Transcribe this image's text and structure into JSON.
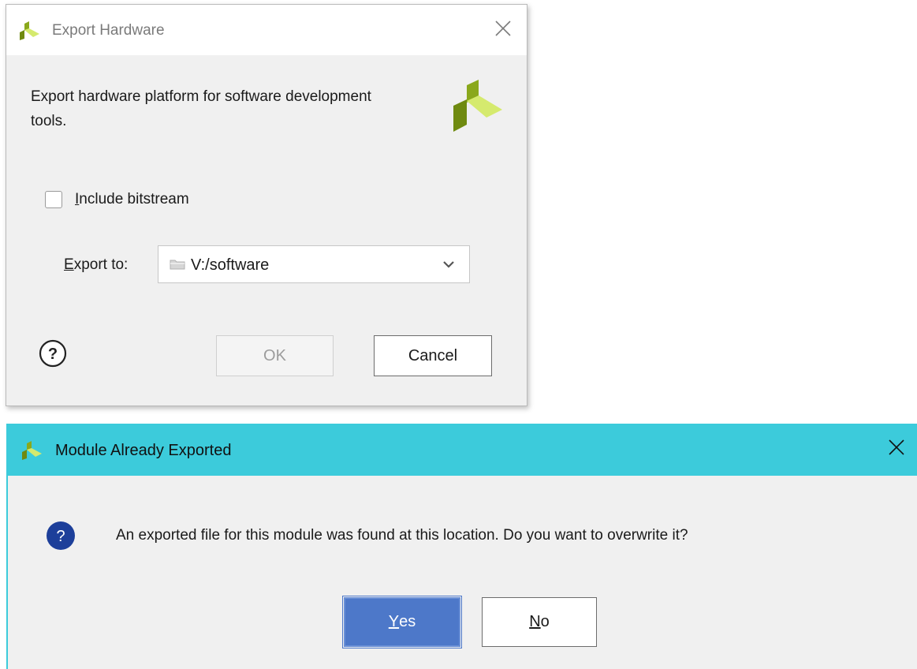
{
  "export_dialog": {
    "title": "Export Hardware",
    "description": "Export hardware platform for software development tools.",
    "include_bitstream": {
      "mnemonic": "I",
      "label_rest": "nclude bitstream",
      "checked": false
    },
    "export_to": {
      "mnemonic": "E",
      "label_rest": "xport to:",
      "value": "V:/software"
    },
    "ok_label": "OK",
    "cancel_label": "Cancel"
  },
  "confirm_dialog": {
    "title": "Module Already Exported",
    "message": "An exported file for this module was found at this location. Do you want to overwrite it?",
    "yes": {
      "mnemonic": "Y",
      "label_rest": "es"
    },
    "no": {
      "mnemonic": "N",
      "label_rest": "o"
    }
  },
  "colors": {
    "title_bar_active": "#3ccbdb",
    "primary_button": "#4d78c9",
    "question_icon": "#1d3f9a",
    "logo_green": "#8aa81c",
    "logo_lime": "#d5ea6e"
  },
  "icons": {
    "app": "xilinx-vivado-logo-icon",
    "close": "close-icon",
    "folder": "folder-icon",
    "dropdown": "chevron-down-icon",
    "help": "help-icon",
    "question": "question-icon"
  }
}
